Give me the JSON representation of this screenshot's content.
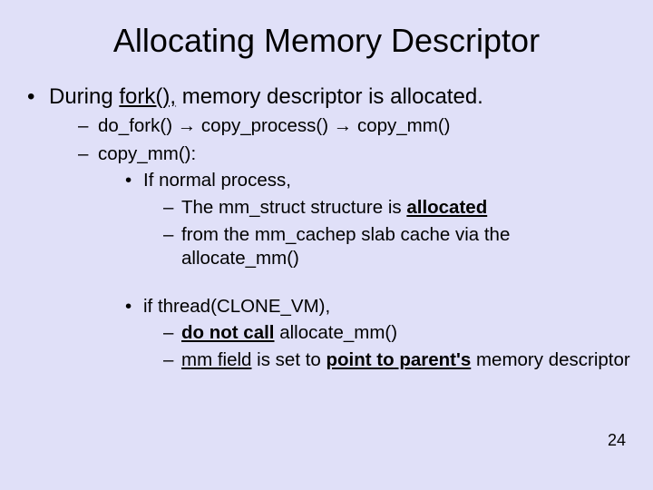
{
  "title": "Allocating Memory Descriptor",
  "bullet1_pre": "During ",
  "bullet1_fork": "fork(),",
  "bullet1_post": "  memory descriptor is allocated.",
  "l2a_a": "do_fork() ",
  "arrow": "→",
  "l2a_b": " copy_process() ",
  "l2a_c": " copy_mm()",
  "l2b": "copy_mm():",
  "l3a": "If normal process,",
  "l4a_pre": "The mm_struct structure is ",
  "l4a_bold": "allocated",
  "l4b_pre": "from the mm_cachep slab cache via the ",
  "l4b_post": "allocate_mm()",
  "l3b": "if thread(CLONE_VM),",
  "l4c_bold": "do not call",
  "l4c_post": "  allocate_mm()",
  "l4d_a": "mm field",
  "l4d_mid": " is set to ",
  "l4d_b": "point to",
  "l4d_c": "  parent's",
  "l4d_post": " memory descriptor",
  "pagenum": "24"
}
